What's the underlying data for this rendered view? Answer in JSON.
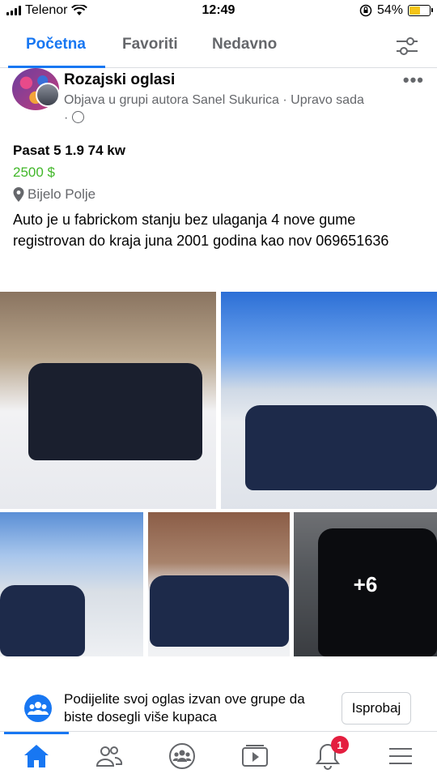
{
  "status_bar": {
    "carrier": "Telenor",
    "time": "12:49",
    "battery_percent": "54%",
    "battery_level": 0.54
  },
  "tabs": [
    {
      "label": "Početna",
      "active": true
    },
    {
      "label": "Favoriti",
      "active": false
    },
    {
      "label": "Nedavno",
      "active": false
    }
  ],
  "post": {
    "group_name": "Rozajski oglasi",
    "meta": "Objava u grupi autora Sanel Sukurica · Upravo sada",
    "meta_suffix": "·"
  },
  "listing": {
    "title": "Pasat 5 1.9 74 kw",
    "price": "2500 $",
    "location": "Bijelo Polje",
    "description": "Auto je u fabrickom stanju bez ulaganja 4 nove gume registrovan do kraja juna 2001 godina kao nov 069651636",
    "more_photos": "+6"
  },
  "share_prompt": {
    "text": "Podijelite svoj oglas izvan ove grupe da biste dosegli više kupaca",
    "button": "Isprobaj"
  },
  "bottom_nav": {
    "notification_count": "1",
    "items": [
      "home-icon",
      "friends-icon",
      "groups-icon",
      "watch-icon",
      "notifications-icon",
      "menu-icon"
    ]
  },
  "colors": {
    "accent": "#1877f2",
    "price": "#42b72a",
    "badge": "#e41e3f"
  }
}
